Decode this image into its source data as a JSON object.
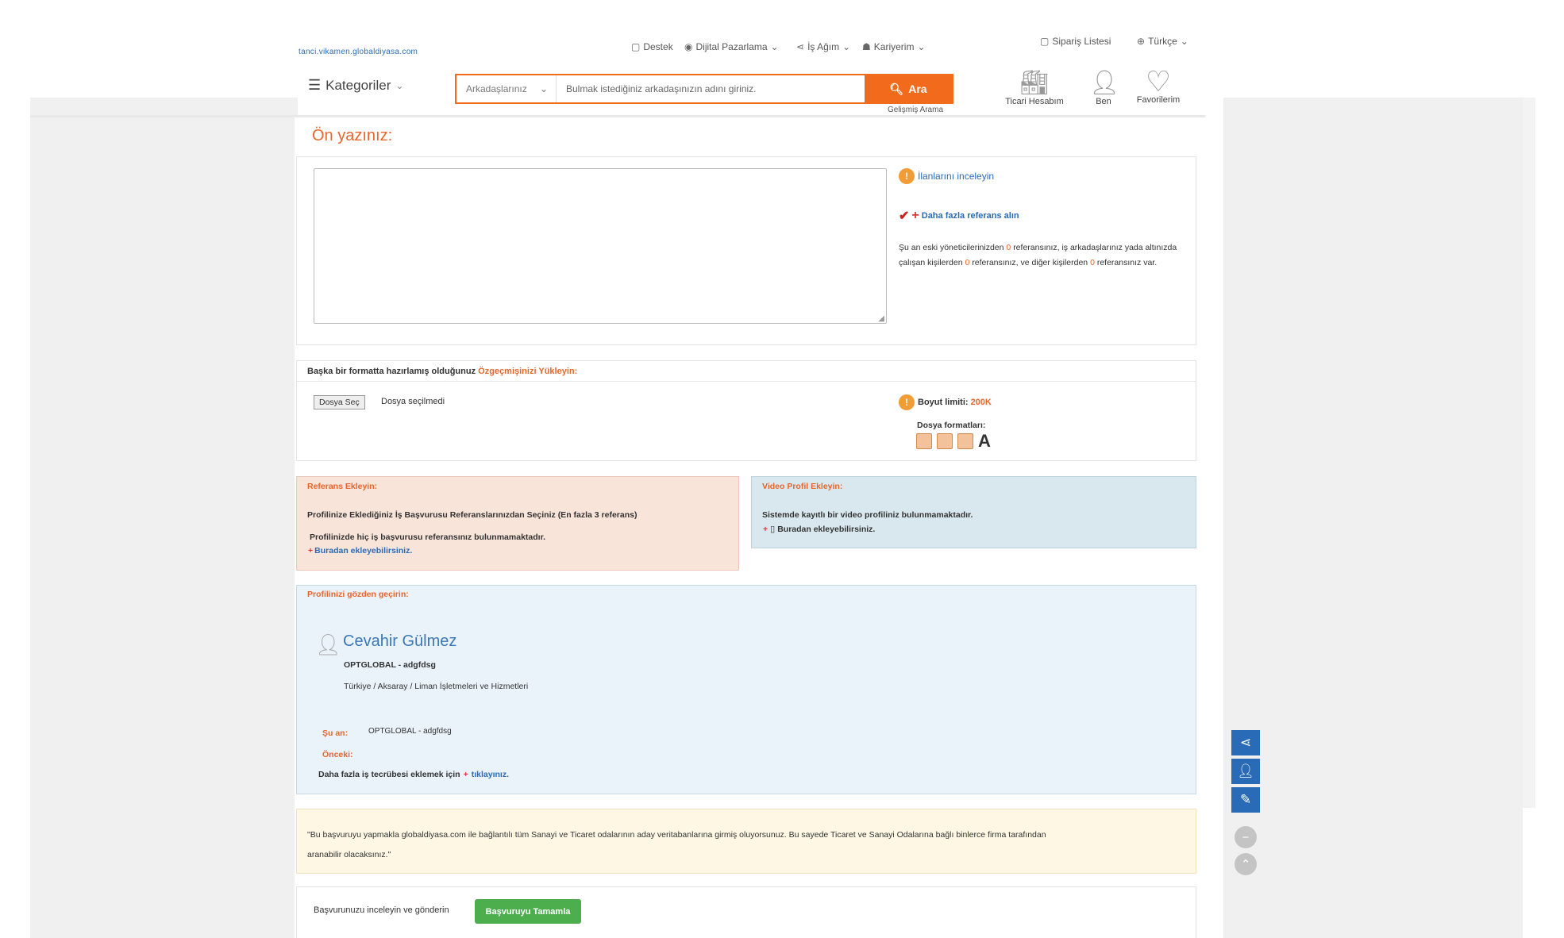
{
  "header": {
    "logo": "tanci.vikamen.globaldiyasa.com",
    "nav": {
      "destek": "Destek",
      "dijital": "Dijital Pazarlama",
      "isagim": "İş Ağım",
      "kariyerim": "Kariyerim"
    },
    "siparis": "Sipariş Listesi",
    "lang": "Türkçe",
    "categories": "Kategoriler",
    "search": {
      "select": "Arkadaşlarınız",
      "placeholder": "Bulmak istediğiniz arkadaşınızın adını giriniz.",
      "button": "Ara",
      "advanced": "Gelişmiş Arama"
    },
    "icons": {
      "ticari": "Ticari Hesabım",
      "ben": "Ben",
      "favoriler": "Favorilerim"
    }
  },
  "cover_letter": {
    "title": "Ön yazınız:",
    "review_link": "İlanlarını inceleyin",
    "more_ref": "Daha fazla referans alın",
    "ref_info_1": "Şu an eski yöneticilerinizden",
    "ref_info_count_1": "0",
    "ref_info_2": "referansınız, iş arkadaşlarınız yada",
    "ref_info_3": "altınızda çalışan kişilerden",
    "ref_info_count_2": "0",
    "ref_info_4": "referansınız, ve diğer kişilerden",
    "ref_info_count_3": "0",
    "ref_info_5": "referansınız var."
  },
  "upload": {
    "prefix": "Başka bir formatta hazırlamış olduğunuz",
    "link": "Özgeçmişinizi Yükleyin:",
    "file_button": "Dosya Seç",
    "file_status": "Dosya seçilmedi",
    "size_label": "Boyut limiti:",
    "size_value": "200K",
    "formats_label": "Dosya formatları:"
  },
  "references": {
    "title": "Referans Ekleyin:",
    "desc": "Profilinize Eklediğiniz İş Başvurusu Referanslarınızdan Seçiniz",
    "desc_note": "(En fazla 3 referans)",
    "none": "Profilinizde hiç iş başvurusu referansınız bulunmamaktadır.",
    "add_link": "Buradan ekleyebilirsiniz."
  },
  "video": {
    "title": "Video Profil Ekleyin:",
    "none": "Sistemde kayıtlı bir video profiliniz bulunmamaktadır.",
    "add_link": "Buradan ekleyebilirsiniz."
  },
  "profile": {
    "title": "Profilinizi gözden geçirin:",
    "name": "Cevahir Gülmez",
    "company": "OPTGLOBAL - adgfdsg",
    "location": "Türkiye / Aksaray / Liman İşletmeleri ve Hizmetleri",
    "current_label": "Şu an:",
    "current_value": "OPTGLOBAL - adgfdsg",
    "previous_label": "Önceki:",
    "more_exp": "Daha fazla iş tecrübesi eklemek için",
    "more_link": "tıklayınız."
  },
  "notice": {
    "line1": "\"Bu başvuruyu yapmakla globaldiyasa.com ile bağlantılı tüm Sanayi ve Ticaret odalarının aday veritabanlarına girmiş oluyorsunuz. Bu sayede Ticaret ve Sanayi Odalarına bağlı binlerce firma tarafından",
    "line2": "aranabilir olacaksınız.\""
  },
  "submit": {
    "label": "Başvurunuzu inceleyin ve gönderin",
    "button": "Başvuruyu Tamamla"
  },
  "colors": {
    "accent": "#f26b1d",
    "link": "#2a6bb8",
    "success": "#4cae4c"
  }
}
